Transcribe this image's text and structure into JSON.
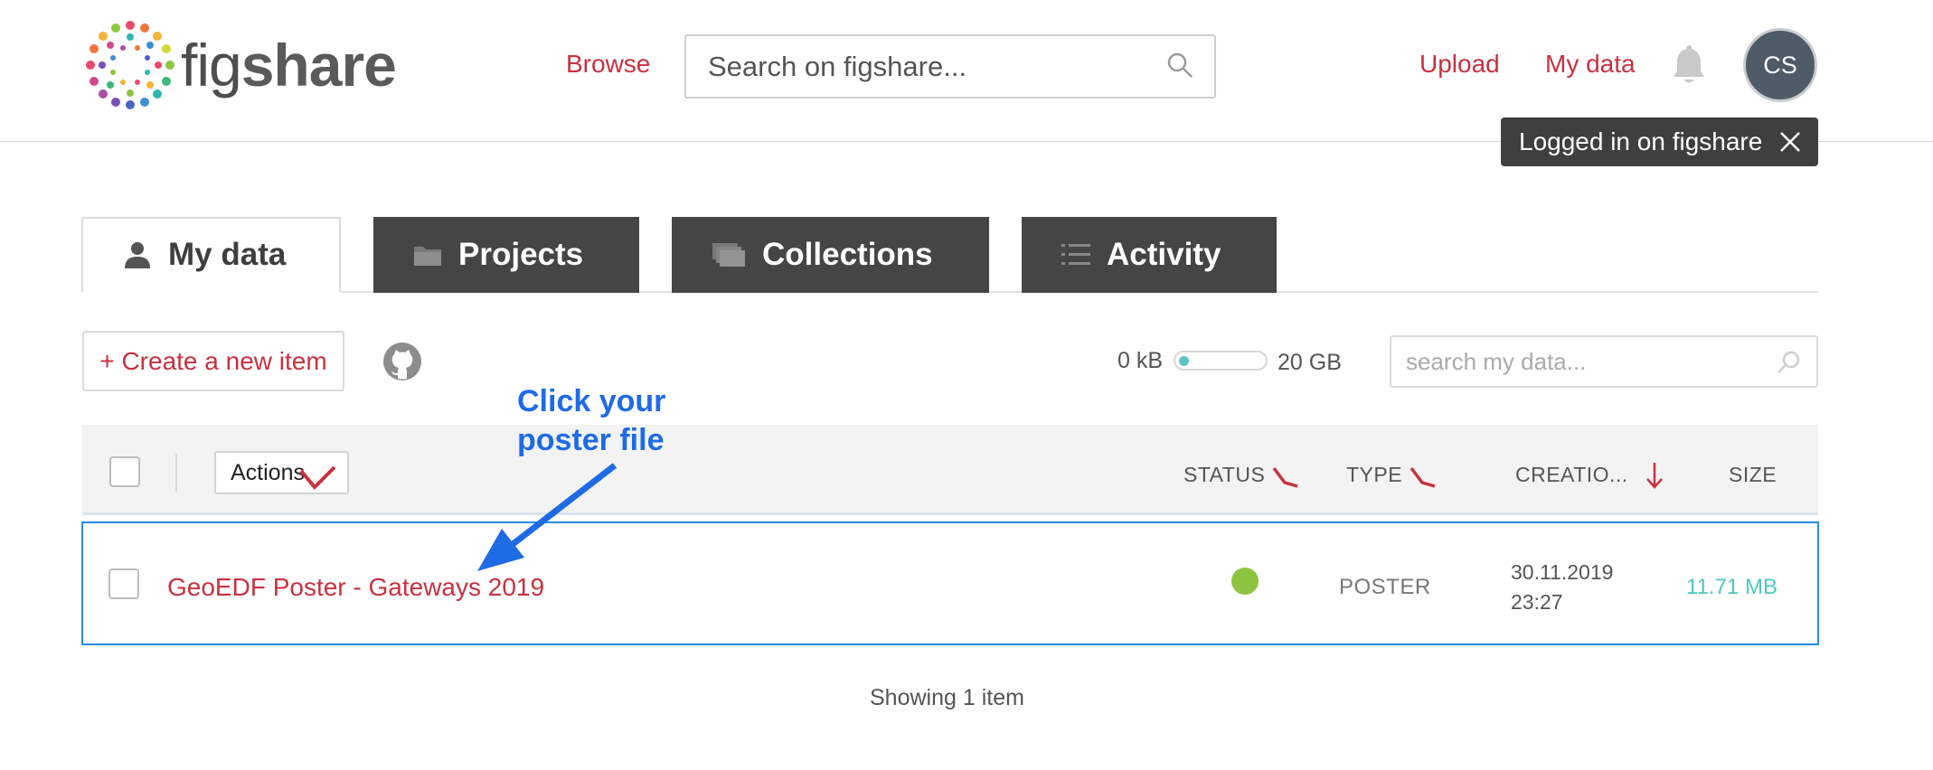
{
  "header": {
    "logo_text_light": "fig",
    "logo_text_bold": "share",
    "browse": "Browse",
    "search_placeholder": "Search on figshare...",
    "upload": "Upload",
    "my_data": "My data",
    "avatar_initials": "CS",
    "toast": "Logged in on figshare"
  },
  "tabs": [
    {
      "label": "My data",
      "icon": "user-icon",
      "active": true
    },
    {
      "label": "Projects",
      "icon": "folder-icon",
      "active": false
    },
    {
      "label": "Collections",
      "icon": "collections-icon",
      "active": false
    },
    {
      "label": "Activity",
      "icon": "list-icon",
      "active": false
    }
  ],
  "toolbar": {
    "create_label": "+ Create a new item",
    "quota_used": "0 kB",
    "quota_total": "20 GB",
    "quota_fraction": 0.0,
    "search_placeholder": "search my data..."
  },
  "table": {
    "actions_label": "Actions",
    "columns": {
      "status": "STATUS",
      "type": "TYPE",
      "created": "CREATIO...",
      "size": "SIZE"
    },
    "rows": [
      {
        "title": "GeoEDF Poster - Gateways 2019",
        "status": "published",
        "status_color": "#8cc43f",
        "type": "POSTER",
        "date": "30.11.2019",
        "time": "23:27",
        "size": "11.71 MB"
      }
    ],
    "footer": "Showing 1 item"
  },
  "annotation": {
    "line1": "Click your",
    "line2": "poster file",
    "color": "#1f6be6"
  },
  "colors": {
    "accent_red": "#c8313f",
    "tab_dark": "#454545",
    "selected_border": "#2a8be3",
    "size_teal": "#4fc7bd"
  }
}
